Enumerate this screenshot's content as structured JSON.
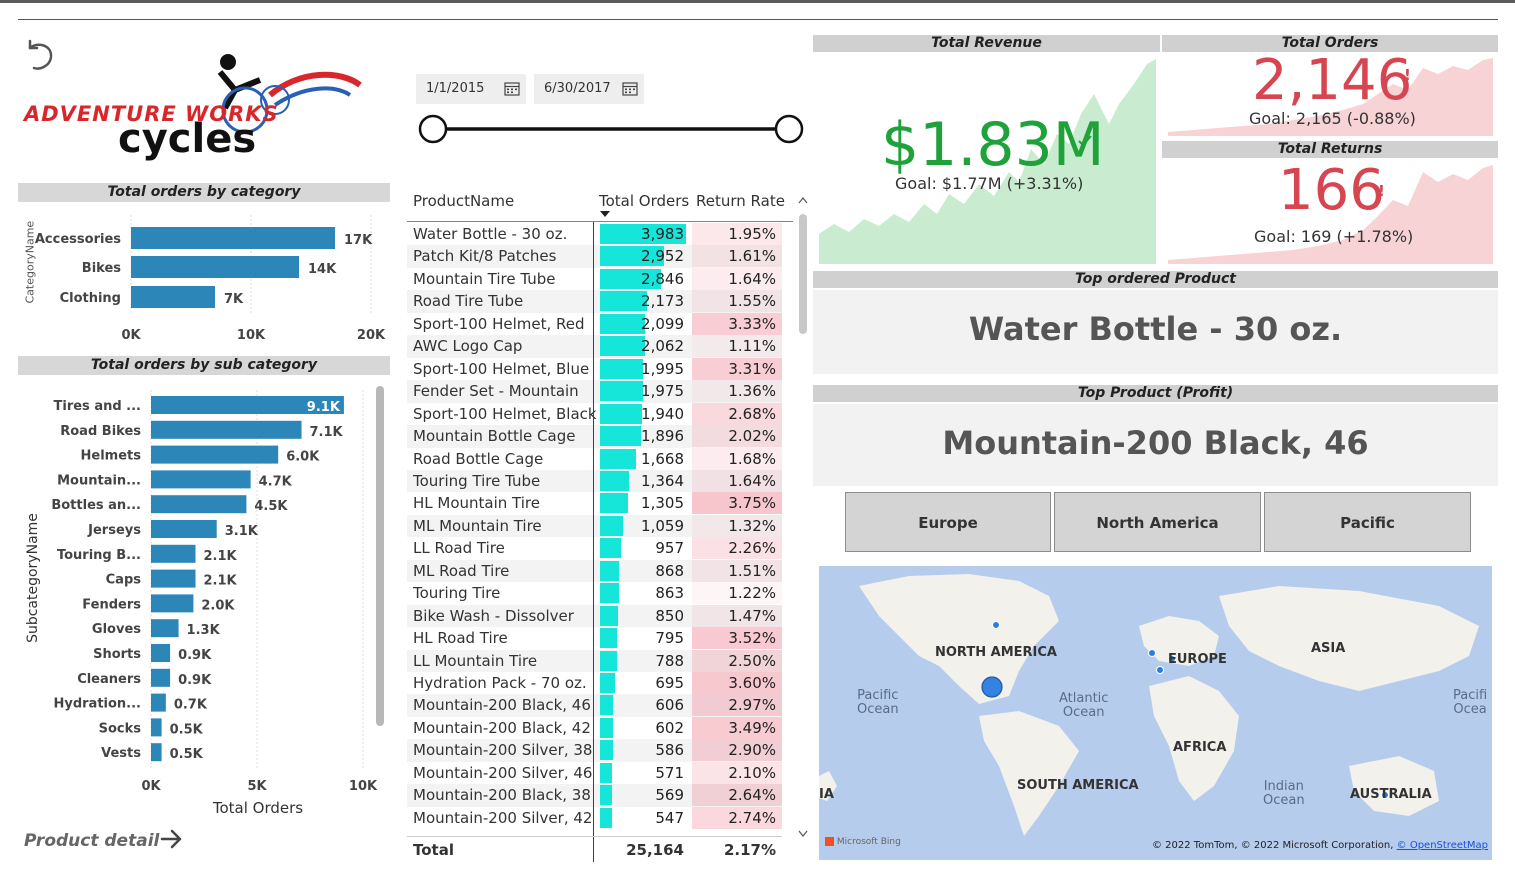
{
  "colors": {
    "teal_bar": "#16e6d9",
    "cat_bar": "#2d86b8",
    "revenue_green": "#1fa23a",
    "orders_red": "#d64550",
    "rr_pink": "#f6c9cf"
  },
  "nav": {
    "back_icon": "undo-arrow-icon",
    "product_detail": "Product detail"
  },
  "logo": {
    "line1": "ADVENTURE WORKS",
    "line2": "cycles"
  },
  "date_slicer": {
    "start": "1/1/2015",
    "end": "6/30/2017"
  },
  "category_chart": {
    "title": "Total orders by category",
    "axis_title": "CategoryName",
    "categories": [
      "Accessories",
      "Bikes",
      "Clothing"
    ],
    "values": [
      17000,
      14000,
      7000
    ],
    "labels": [
      "17K",
      "14K",
      "7K"
    ],
    "xticks": [
      "0K",
      "10K",
      "20K"
    ],
    "xmax": 20000
  },
  "subcategory_chart": {
    "title": "Total orders by sub category",
    "axis_title": "SubcategoryName",
    "x_axis_title": "Total Orders",
    "categories": [
      "Tires and ...",
      "Road Bikes",
      "Helmets",
      "Mountain...",
      "Bottles an...",
      "Jerseys",
      "Touring B...",
      "Caps",
      "Fenders",
      "Gloves",
      "Shorts",
      "Cleaners",
      "Hydration...",
      "Socks",
      "Vests"
    ],
    "values": [
      9100,
      7100,
      6000,
      4700,
      4500,
      3100,
      2100,
      2100,
      2000,
      1300,
      900,
      900,
      700,
      500,
      500
    ],
    "labels": [
      "9.1K",
      "7.1K",
      "6.0K",
      "4.7K",
      "4.5K",
      "3.1K",
      "2.1K",
      "2.1K",
      "2.0K",
      "1.3K",
      "0.9K",
      "0.9K",
      "0.7K",
      "0.5K",
      "0.5K"
    ],
    "xticks": [
      "0K",
      "5K",
      "10K"
    ],
    "xmax": 10000
  },
  "table": {
    "headers": [
      "ProductName",
      "Total Orders",
      "Return Rate"
    ],
    "rows": [
      [
        "Water Bottle - 30 oz.",
        "3,983",
        "1.95%"
      ],
      [
        "Patch Kit/8 Patches",
        "2,952",
        "1.61%"
      ],
      [
        "Mountain Tire Tube",
        "2,846",
        "1.64%"
      ],
      [
        "Road Tire Tube",
        "2,173",
        "1.55%"
      ],
      [
        "Sport-100 Helmet, Red",
        "2,099",
        "3.33%"
      ],
      [
        "AWC Logo Cap",
        "2,062",
        "1.11%"
      ],
      [
        "Sport-100 Helmet, Blue",
        "1,995",
        "3.31%"
      ],
      [
        "Fender Set - Mountain",
        "1,975",
        "1.36%"
      ],
      [
        "Sport-100 Helmet, Black",
        "1,940",
        "2.68%"
      ],
      [
        "Mountain Bottle Cage",
        "1,896",
        "2.02%"
      ],
      [
        "Road Bottle Cage",
        "1,668",
        "1.68%"
      ],
      [
        "Touring Tire Tube",
        "1,364",
        "1.64%"
      ],
      [
        "HL Mountain Tire",
        "1,305",
        "3.75%"
      ],
      [
        "ML Mountain Tire",
        "1,059",
        "1.32%"
      ],
      [
        "LL Road Tire",
        "957",
        "2.26%"
      ],
      [
        "ML Road Tire",
        "868",
        "1.51%"
      ],
      [
        "Touring Tire",
        "863",
        "1.22%"
      ],
      [
        "Bike Wash - Dissolver",
        "850",
        "1.47%"
      ],
      [
        "HL Road Tire",
        "795",
        "3.52%"
      ],
      [
        "LL Mountain Tire",
        "788",
        "2.50%"
      ],
      [
        "Hydration Pack - 70 oz.",
        "695",
        "3.60%"
      ],
      [
        "Mountain-200 Black, 46",
        "606",
        "2.97%"
      ],
      [
        "Mountain-200 Black, 42",
        "602",
        "3.49%"
      ],
      [
        "Mountain-200 Silver, 38",
        "586",
        "2.90%"
      ],
      [
        "Mountain-200 Silver, 46",
        "571",
        "2.10%"
      ],
      [
        "Mountain-200 Black, 38",
        "569",
        "2.64%"
      ],
      [
        "Mountain-200 Silver, 42",
        "547",
        "2.74%"
      ]
    ],
    "order_values": [
      3983,
      2952,
      2846,
      2173,
      2099,
      2062,
      1995,
      1975,
      1940,
      1896,
      1668,
      1364,
      1305,
      1059,
      957,
      868,
      863,
      850,
      795,
      788,
      695,
      606,
      602,
      586,
      571,
      569,
      547
    ],
    "return_values": [
      1.95,
      1.61,
      1.64,
      1.55,
      3.33,
      1.11,
      3.31,
      1.36,
      2.68,
      2.02,
      1.68,
      1.64,
      3.75,
      1.32,
      2.26,
      1.51,
      1.22,
      1.47,
      3.52,
      2.5,
      3.6,
      2.97,
      3.49,
      2.9,
      2.1,
      2.64,
      2.74
    ],
    "total_label": "Total",
    "total_orders": "25,164",
    "total_return_rate": "2.17%"
  },
  "kpi": {
    "revenue": {
      "title": "Total Revenue",
      "value": "$1.83M",
      "goal": "Goal: $1.77M (+3.31%)",
      "status_icon": "checkmark-icon"
    },
    "orders": {
      "title": "Total Orders",
      "value": "2,146",
      "goal": "Goal: 2,165 (-0.88%)",
      "status_icon": "exclamation-icon"
    },
    "returns": {
      "title": "Total Returns",
      "value": "166",
      "goal": "Goal: 169 (+1.78%)",
      "status_icon": "exclamation-icon"
    }
  },
  "cards": {
    "top_ordered": {
      "title": "Top ordered Product",
      "value": "Water Bottle - 30 oz."
    },
    "top_profit": {
      "title": "Top Product (Profit)",
      "value": "Mountain-200 Black, 46"
    }
  },
  "regions": [
    "Europe",
    "North America",
    "Pacific"
  ],
  "map": {
    "labels": {
      "north_america": "NORTH AMERICA",
      "europe": "EUROPE",
      "asia": "ASIA",
      "africa": "AFRICA",
      "south_america": "SOUTH AMERICA",
      "australia": "AUSTRALIA",
      "ia": "IA"
    },
    "oceans": {
      "pacific_left_1": "Pacific",
      "pacific_left_2": "Ocean",
      "atlantic_1": "Atlantic",
      "atlantic_2": "Ocean",
      "indian_1": "Indian",
      "indian_2": "Ocean",
      "pacific_right_1": "Pacifi",
      "pacific_right_2": "Ocea"
    },
    "bing": "Microsoft Bing",
    "credit": "© 2022 TomTom, © 2022 Microsoft Corporation,",
    "credit_link": "© OpenStreetMap"
  }
}
